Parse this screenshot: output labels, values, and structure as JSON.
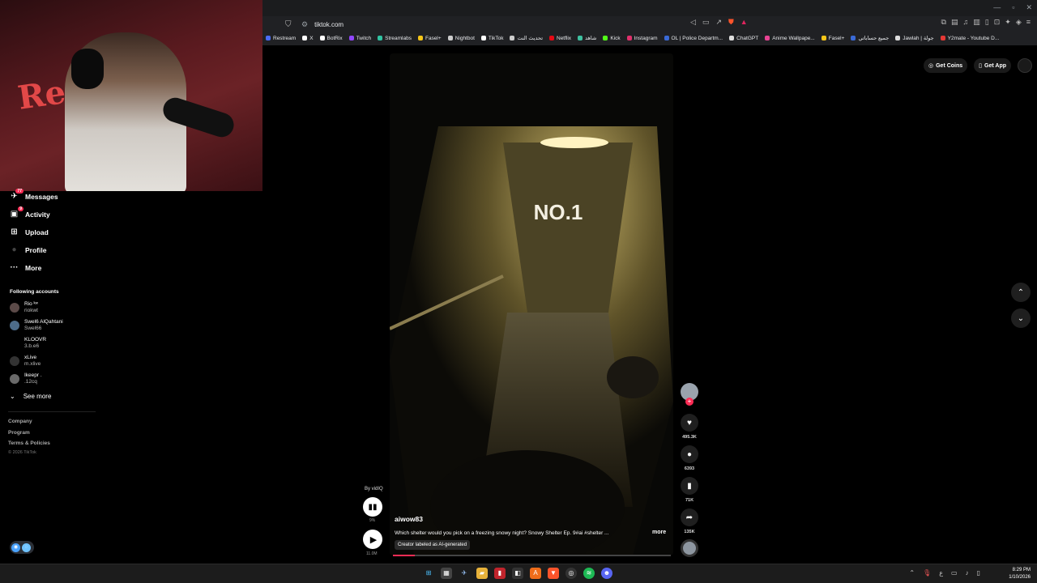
{
  "browser": {
    "url": "tiktok.com",
    "bookmarks": [
      {
        "label": "Restream",
        "color": "#4a6cf7"
      },
      {
        "label": "X",
        "color": "#ffffff"
      },
      {
        "label": "BotRix",
        "color": "#ffffff"
      },
      {
        "label": "Twitch",
        "color": "#9146ff"
      },
      {
        "label": "Streamlabs",
        "color": "#31c3a2"
      },
      {
        "label": "Fasel+",
        "color": "#f5c518"
      },
      {
        "label": "Nightbot",
        "color": "#cccccc"
      },
      {
        "label": "TikTok",
        "color": "#ffffff"
      },
      {
        "label": "تحديث النت",
        "color": "#cccccc"
      },
      {
        "label": "Netflix",
        "color": "#e50914"
      },
      {
        "label": "شاهد",
        "color": "#3ec1a0"
      },
      {
        "label": "Kick",
        "color": "#53fc18"
      },
      {
        "label": "Instagram",
        "color": "#e1306c"
      },
      {
        "label": "OL | Police Departm...",
        "color": "#3a6ad6"
      },
      {
        "label": "ChatGPT",
        "color": "#dddddd"
      },
      {
        "label": "Anime Wallpape...",
        "color": "#e84393"
      },
      {
        "label": "Fasel+",
        "color": "#f5c518"
      },
      {
        "label": "جميع حساباتي",
        "color": "#3a6ad6"
      },
      {
        "label": "Jawlah | جولة",
        "color": "#dddddd"
      },
      {
        "label": "Y2mate - Youtube D...",
        "color": "#e53935"
      }
    ]
  },
  "sidebar": {
    "nav": [
      {
        "label": "Messages",
        "icon": "send-icon",
        "glyph": "✈",
        "badge": "77"
      },
      {
        "label": "Activity",
        "icon": "inbox-icon",
        "glyph": "▣",
        "badge": "9"
      },
      {
        "label": "Upload",
        "icon": "plus-square-icon",
        "glyph": "⊞",
        "badge": ""
      },
      {
        "label": "Profile",
        "icon": "avatar-icon",
        "glyph": "●",
        "badge": ""
      },
      {
        "label": "More",
        "icon": "more-icon",
        "glyph": "···",
        "badge": ""
      }
    ],
    "following_title": "Following accounts",
    "accounts": [
      {
        "name": "Rio ᵏʷ",
        "handle": "riokwt"
      },
      {
        "name": "Swel6 AlQahtani",
        "handle": "Swel66"
      },
      {
        "name": "KLOOVR",
        "handle": "3.b.e6"
      },
      {
        "name": "xLive",
        "handle": "m.xlive"
      },
      {
        "name": "Ikeepr .",
        "handle": ".12cq"
      }
    ],
    "see_more": "See more",
    "footer": {
      "company": "Company",
      "program": "Program",
      "terms": "Terms & Policies",
      "copyright": "© 2026 TikTok"
    }
  },
  "topbar": {
    "get_coins": "Get Coins",
    "get_app": "Get App"
  },
  "video": {
    "by": "By vidIQ",
    "stats_pct": "9%",
    "views": "11.0M",
    "author": "aiwow83",
    "description": "Which shelter would you pick on a freezing snowy night? Snowy Shelter Ep. 9#ai #shelter ...",
    "more": "more",
    "ai_label": "Creator labeled as AI-generated",
    "door_text": "NO.1",
    "progress": 0.08
  },
  "actions": {
    "likes": "495.3K",
    "comments": "6393",
    "saves": "71K",
    "shares": "135K"
  },
  "clock": {
    "time": "8:29 PM",
    "date": "1/10/2026"
  }
}
